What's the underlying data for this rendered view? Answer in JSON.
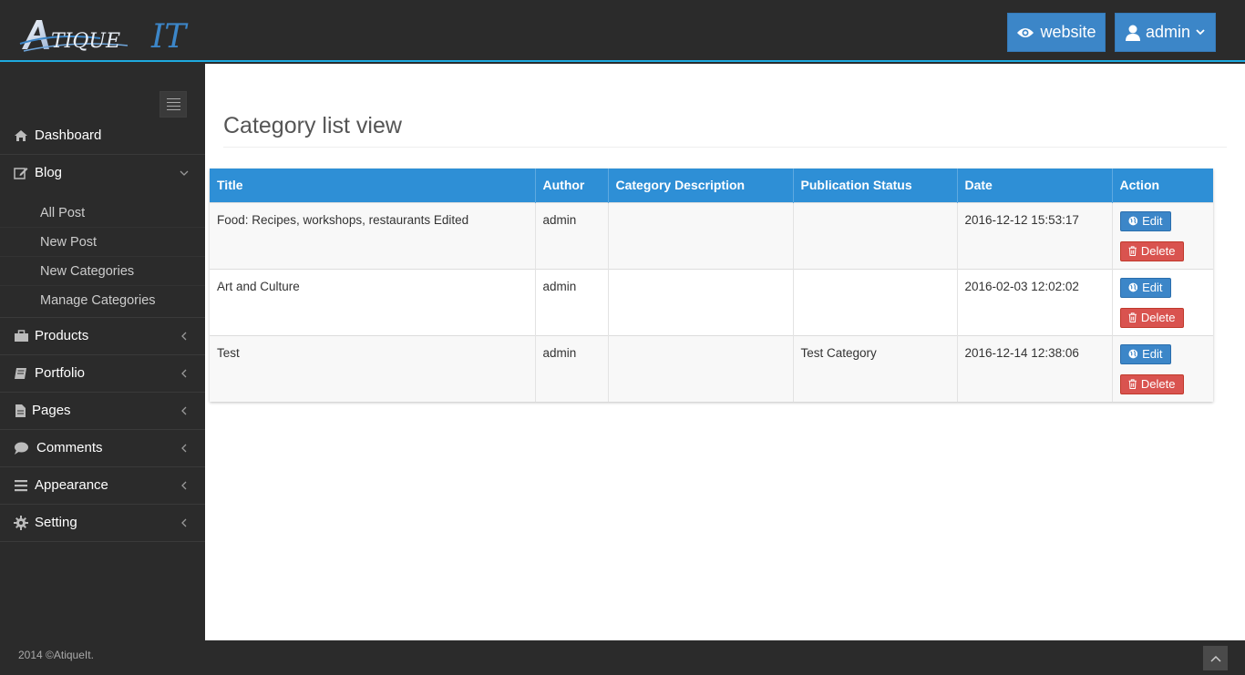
{
  "header": {
    "logo_text": "ATIQUE IT",
    "website_button": "website",
    "admin_button": "admin"
  },
  "sidebar": {
    "items": [
      {
        "label": "Dashboard",
        "icon": "home-icon"
      },
      {
        "label": "Blog",
        "icon": "edit-icon",
        "expanded": true,
        "children": [
          "All Post",
          "New Post",
          "New Categories",
          "Manage Categories"
        ]
      },
      {
        "label": "Products",
        "icon": "briefcase-icon"
      },
      {
        "label": "Portfolio",
        "icon": "book-icon"
      },
      {
        "label": "Pages",
        "icon": "file-icon"
      },
      {
        "label": "Comments",
        "icon": "comment-icon"
      },
      {
        "label": "Appearance",
        "icon": "list-icon"
      },
      {
        "label": "Setting",
        "icon": "gear-icon"
      }
    ]
  },
  "main": {
    "page_title": "Category list view",
    "table": {
      "columns": [
        "Title",
        "Author",
        "Category Description",
        "Publication Status",
        "Date",
        "Action"
      ],
      "rows": [
        {
          "title": "Food: Recipes, workshops, restaurants Edited",
          "author": "admin",
          "description": "",
          "status": "",
          "date": "2016-12-12 15:53:17"
        },
        {
          "title": "Art and Culture",
          "author": "admin",
          "description": "",
          "status": "",
          "date": "2016-02-03 12:02:02"
        },
        {
          "title": "Test",
          "author": "admin",
          "description": "",
          "status": "Test Category",
          "date": "2016-12-14 12:38:06"
        }
      ],
      "edit_label": "Edit",
      "delete_label": "Delete"
    }
  },
  "footer": {
    "copyright": "2014 ©AtiqueIt."
  },
  "colors": {
    "header_bg": "#2b2b2b",
    "accent_blue": "#2e8fd6",
    "button_blue": "#3c86c8",
    "danger_red": "#d9534f",
    "header_border": "#1eaadf"
  }
}
